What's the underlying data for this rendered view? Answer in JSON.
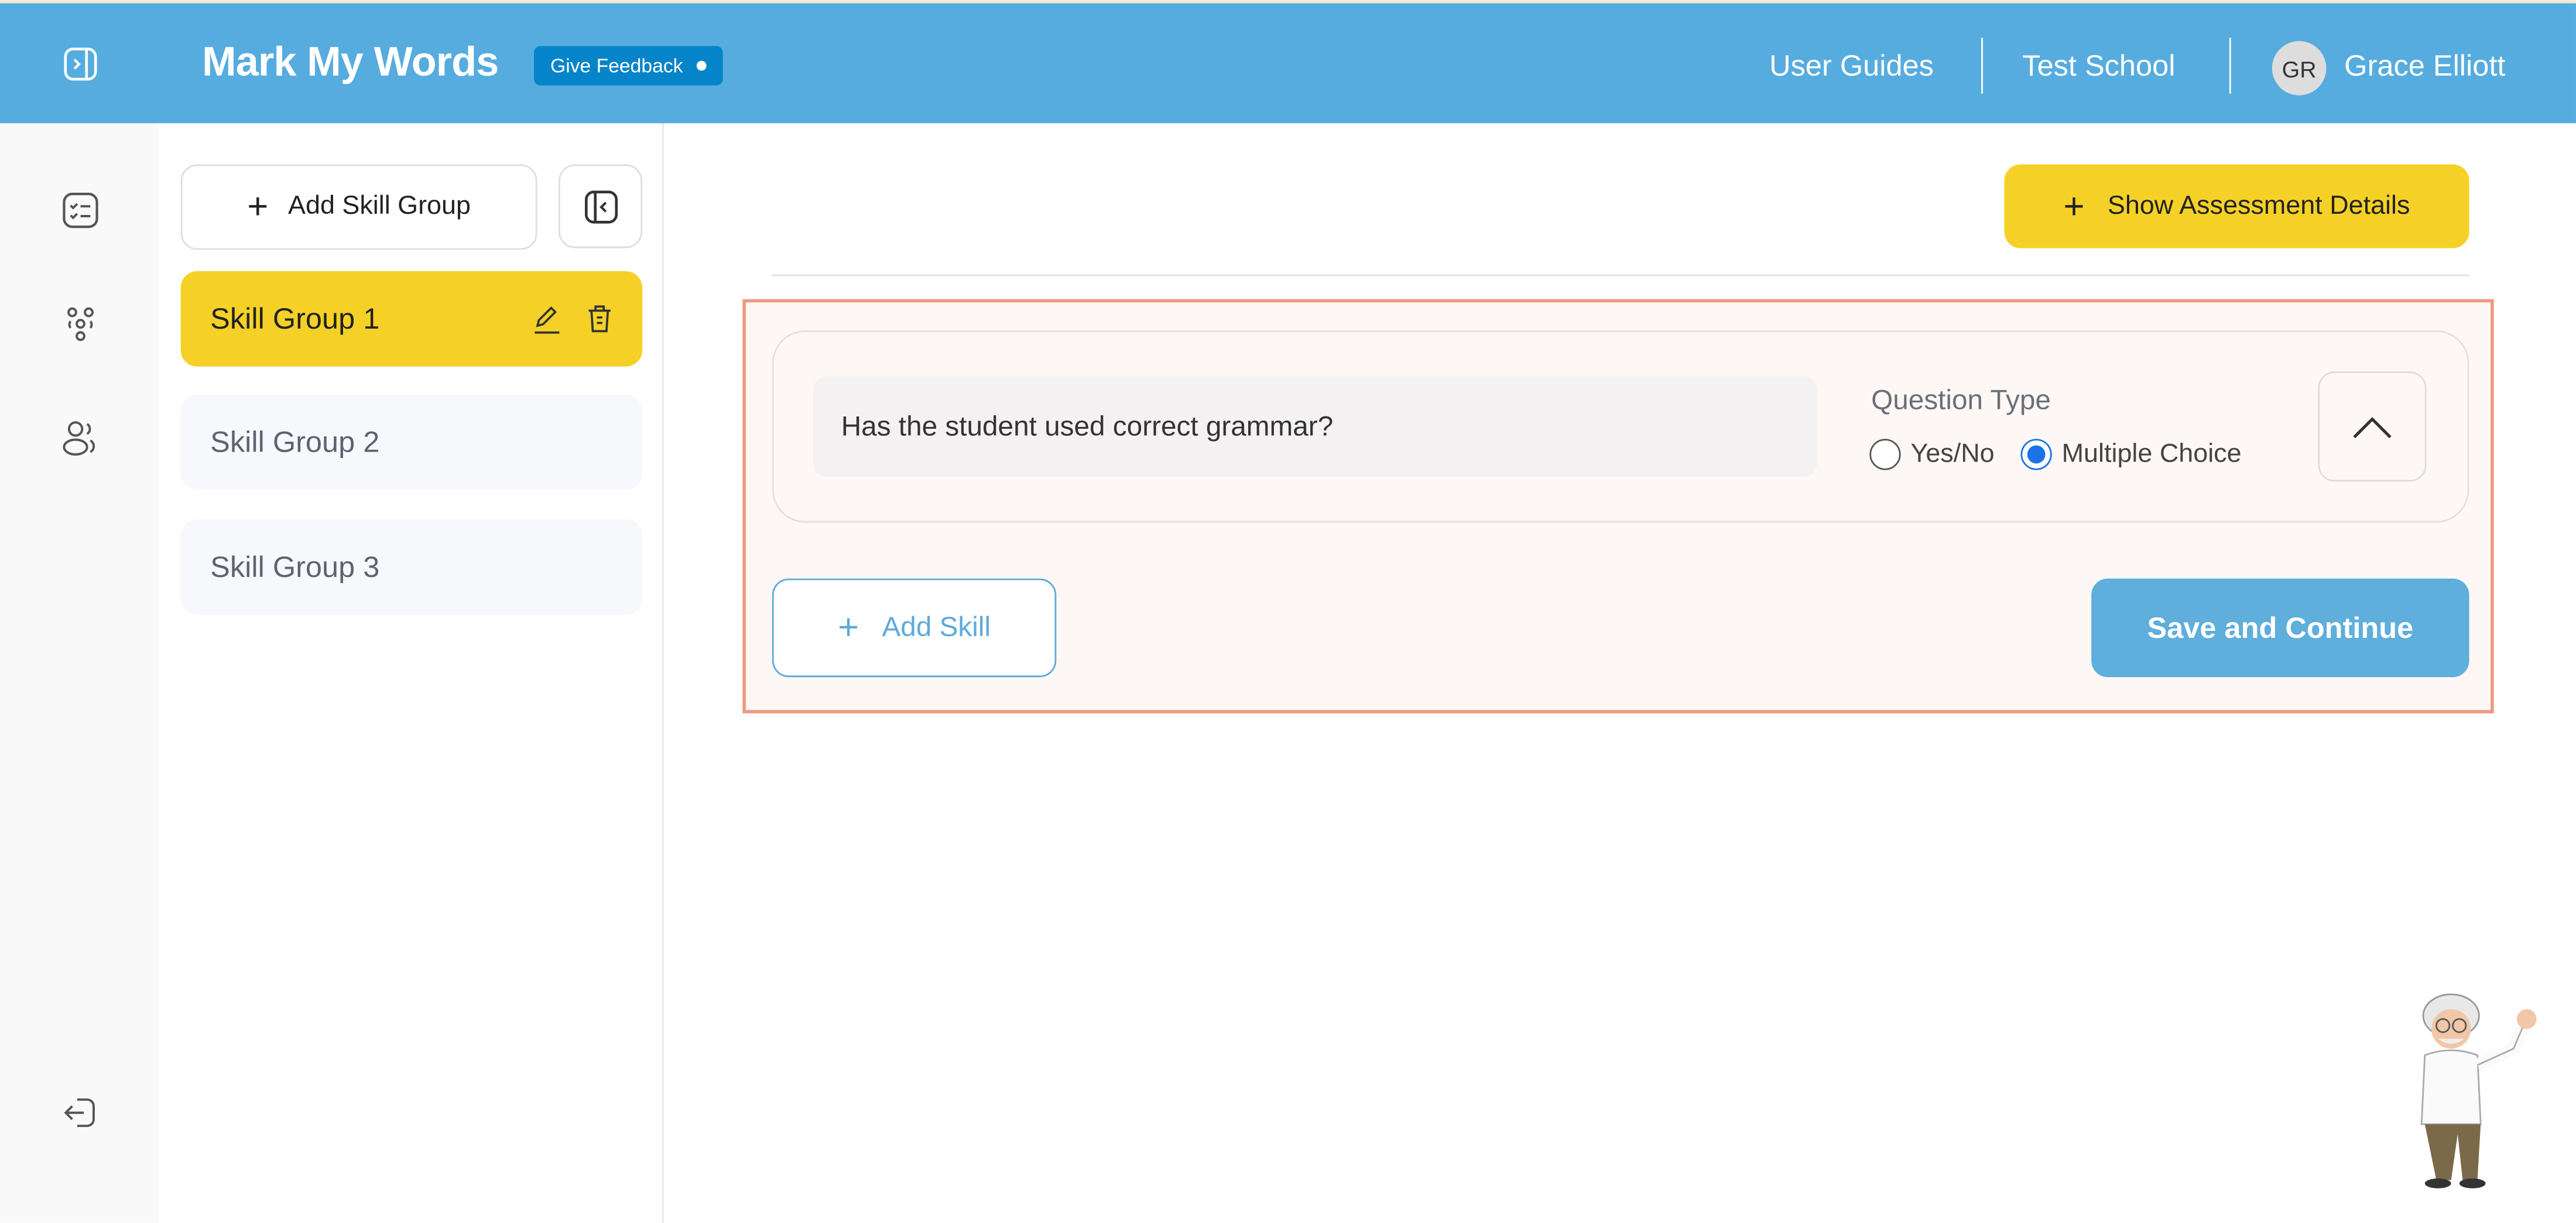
{
  "header": {
    "app_title": "Mark My Words",
    "feedback_label": "Give Feedback",
    "nav": {
      "user_guides": "User Guides",
      "school": "Test School",
      "user_initials": "GR",
      "user_name": "Grace Elliott"
    },
    "color": "#56acdf"
  },
  "rail": {
    "icons": [
      "sidebar-expand-icon",
      "checklist-icon",
      "groups-icon",
      "users-icon",
      "logout-icon"
    ]
  },
  "sidebar": {
    "add_label": "Add Skill Group",
    "items": [
      {
        "label": "Skill Group 1",
        "active": true
      },
      {
        "label": "Skill Group 2",
        "active": false
      },
      {
        "label": "Skill Group 3",
        "active": false
      }
    ]
  },
  "main": {
    "show_details_label": "Show Assessment Details",
    "question": {
      "value": "Has the student used correct grammar?"
    },
    "question_type": {
      "label": "Question Type",
      "options": [
        "Yes/No",
        "Multiple Choice"
      ],
      "selected": "Multiple Choice"
    },
    "add_skill_label": "Add Skill",
    "save_label": "Save and Continue"
  },
  "colors": {
    "accent_yellow": "#f5d127",
    "highlight_border": "#ee9a80",
    "primary_blue": "#5faedb"
  }
}
